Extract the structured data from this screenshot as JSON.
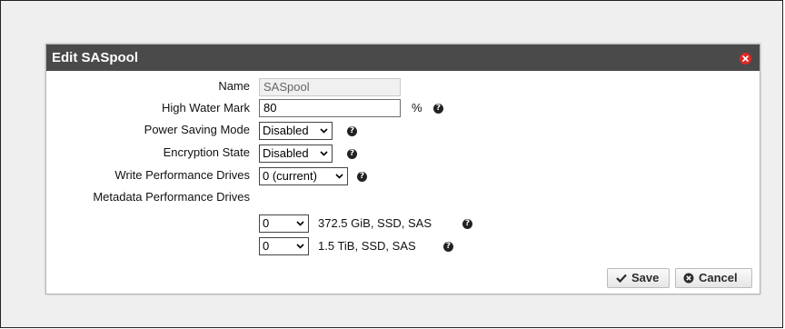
{
  "dialog": {
    "title": "Edit SASpool"
  },
  "form": {
    "name": {
      "label": "Name",
      "value": "SASpool"
    },
    "high_water_mark": {
      "label": "High Water Mark",
      "value": "80",
      "unit": "%"
    },
    "power_saving_mode": {
      "label": "Power Saving Mode",
      "value": "Disabled"
    },
    "encryption_state": {
      "label": "Encryption State",
      "value": "Disabled"
    },
    "write_performance_drives": {
      "label": "Write Performance Drives",
      "value": "0 (current)"
    },
    "metadata_performance_drives": {
      "label": "Metadata Performance Drives",
      "rows": [
        {
          "value": "0",
          "description": "372.5 GiB, SSD, SAS"
        },
        {
          "value": "0",
          "description": "1.5 TiB, SSD, SAS"
        }
      ]
    }
  },
  "buttons": {
    "save": "Save",
    "cancel": "Cancel"
  },
  "icons": {
    "help": "question-circle",
    "close": "close-circle",
    "save": "checkmark",
    "cancel": "cancel-circle"
  },
  "colors": {
    "titlebar": "#4a4a4a",
    "close": "#e02626",
    "backdrop": "#efefef"
  }
}
